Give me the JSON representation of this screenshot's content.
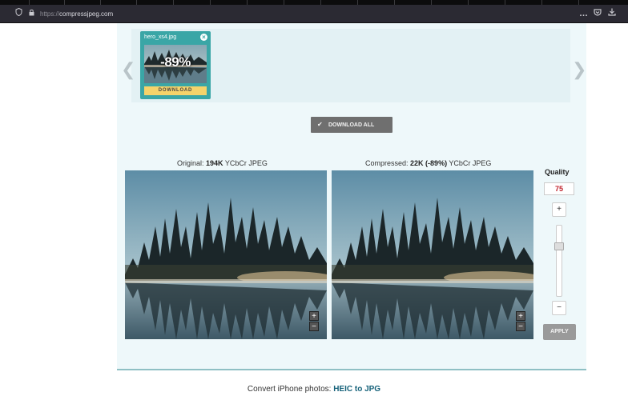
{
  "browser": {
    "url_protocol": "https://",
    "url_host": "compressjpeg.com",
    "more_icon": "…",
    "pocket_icon": "pocket-icon",
    "download_icon": "download-icon"
  },
  "carousel": {
    "prev_arrow": "❮",
    "next_arrow": "❯",
    "item": {
      "filename": "hero_xs4.jpg",
      "percent": "-89%",
      "download_label": "DOWNLOAD",
      "close": "×"
    }
  },
  "download_all": {
    "icon": "✔",
    "label": "DOWNLOAD ALL"
  },
  "original": {
    "prefix": "Original:",
    "size": "194K",
    "format": "YCbCr JPEG"
  },
  "compressed": {
    "prefix": "Compressed:",
    "size": "22K (-89%)",
    "format": "YCbCr JPEG"
  },
  "zoom": {
    "in": "+",
    "out": "−"
  },
  "quality": {
    "label": "Quality",
    "value": "75",
    "plus": "+",
    "minus": "−",
    "apply": "APPLY",
    "level_fraction": 0.75
  },
  "footer": {
    "text": "Convert iPhone photos:",
    "link": "HEIC to JPG"
  },
  "colors": {
    "accent": "#3aa6a6",
    "download": "#f5d36b",
    "quality_value": "#c0202a"
  }
}
